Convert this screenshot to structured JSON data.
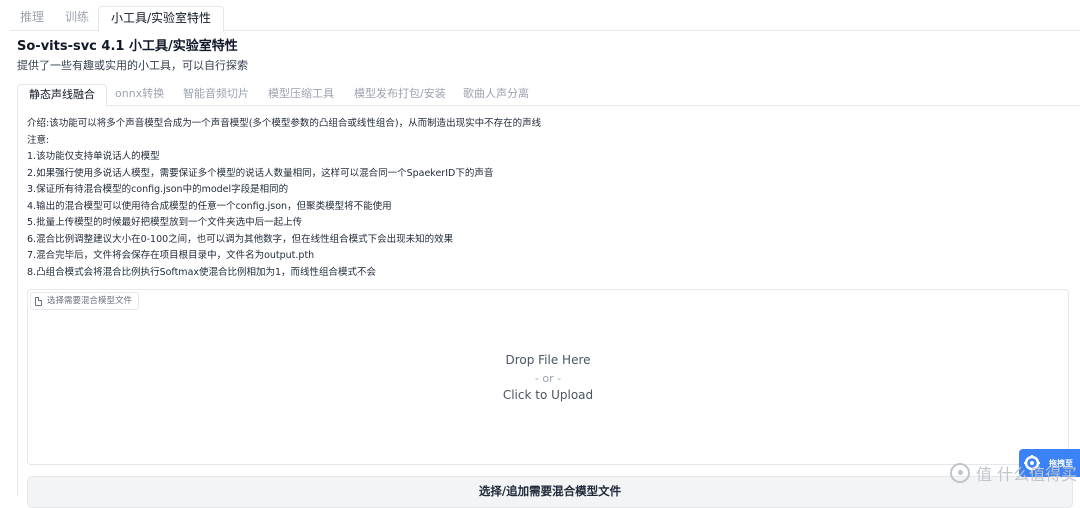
{
  "top_tabs": [
    {
      "label": "推理",
      "active": false
    },
    {
      "label": "训练",
      "active": false
    },
    {
      "label": "小工具/实验室特性",
      "active": true
    }
  ],
  "header": {
    "title": "So-vits-svc 4.1 小工具/实验室特性",
    "subtitle": "提供了一些有趣或实用的小工具，可以自行探索"
  },
  "sub_tabs": [
    {
      "label": "静态声线融合",
      "active": true
    },
    {
      "label": "onnx转换",
      "active": false
    },
    {
      "label": "智能音频切片",
      "active": false
    },
    {
      "label": "模型压缩工具",
      "active": false
    },
    {
      "label": "模型发布打包/安装",
      "active": false
    },
    {
      "label": "歌曲人声分离",
      "active": false
    }
  ],
  "notes": [
    "介绍:该功能可以将多个声音模型合成为一个声音模型(多个模型参数的凸组合或线性组合)，从而制造出现实中不存在的声线",
    "注意:",
    "1.该功能仅支持单说话人的模型",
    "2.如果强行使用多说话人模型，需要保证多个模型的说话人数量相同，这样可以混合同一个SpaekerID下的声音",
    "3.保证所有待混合模型的config.json中的model字段是相同的",
    "4.输出的混合模型可以使用待合成模型的任意一个config.json，但聚类模型将不能使用",
    "5.批量上传模型的时候最好把模型放到一个文件夹选中后一起上传",
    "6.混合比例调整建议大小在0-100之间，也可以调为其他数字，但在线性组合模式下会出现未知的效果",
    "7.混合完毕后，文件将会保存在项目根目录中，文件名为output.pth",
    "8.凸组合模式会将混合比例执行Softmax使混合比例相加为1，而线性组合模式不会"
  ],
  "upload": {
    "label": "选择需要混合模型文件",
    "drop_text": "Drop File Here",
    "or_text": "- or -",
    "click_text": "Click to Upload"
  },
  "main_button": "选择/追加需要混合模型文件",
  "float_widget": {
    "label": "拖拽至"
  },
  "watermark": "值 什么值得买",
  "colors": {
    "accent": "#3b82f6",
    "border": "#e5e7eb",
    "button_bg": "#f3f4f6"
  },
  "icons": {
    "upload_label": "file-icon",
    "float_widget": "gear-icon",
    "watermark": "logo-icon"
  }
}
